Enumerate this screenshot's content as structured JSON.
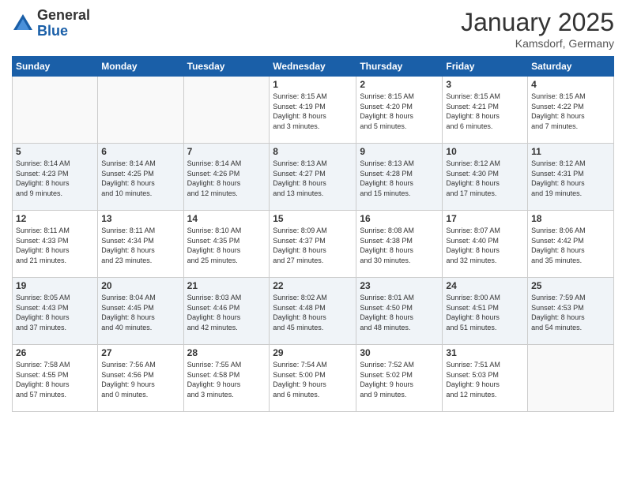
{
  "header": {
    "logo_general": "General",
    "logo_blue": "Blue",
    "month_title": "January 2025",
    "location": "Kamsdorf, Germany"
  },
  "days_of_week": [
    "Sunday",
    "Monday",
    "Tuesday",
    "Wednesday",
    "Thursday",
    "Friday",
    "Saturday"
  ],
  "weeks": [
    [
      {
        "day": "",
        "info": ""
      },
      {
        "day": "",
        "info": ""
      },
      {
        "day": "",
        "info": ""
      },
      {
        "day": "1",
        "info": "Sunrise: 8:15 AM\nSunset: 4:19 PM\nDaylight: 8 hours\nand 3 minutes."
      },
      {
        "day": "2",
        "info": "Sunrise: 8:15 AM\nSunset: 4:20 PM\nDaylight: 8 hours\nand 5 minutes."
      },
      {
        "day": "3",
        "info": "Sunrise: 8:15 AM\nSunset: 4:21 PM\nDaylight: 8 hours\nand 6 minutes."
      },
      {
        "day": "4",
        "info": "Sunrise: 8:15 AM\nSunset: 4:22 PM\nDaylight: 8 hours\nand 7 minutes."
      }
    ],
    [
      {
        "day": "5",
        "info": "Sunrise: 8:14 AM\nSunset: 4:23 PM\nDaylight: 8 hours\nand 9 minutes."
      },
      {
        "day": "6",
        "info": "Sunrise: 8:14 AM\nSunset: 4:25 PM\nDaylight: 8 hours\nand 10 minutes."
      },
      {
        "day": "7",
        "info": "Sunrise: 8:14 AM\nSunset: 4:26 PM\nDaylight: 8 hours\nand 12 minutes."
      },
      {
        "day": "8",
        "info": "Sunrise: 8:13 AM\nSunset: 4:27 PM\nDaylight: 8 hours\nand 13 minutes."
      },
      {
        "day": "9",
        "info": "Sunrise: 8:13 AM\nSunset: 4:28 PM\nDaylight: 8 hours\nand 15 minutes."
      },
      {
        "day": "10",
        "info": "Sunrise: 8:12 AM\nSunset: 4:30 PM\nDaylight: 8 hours\nand 17 minutes."
      },
      {
        "day": "11",
        "info": "Sunrise: 8:12 AM\nSunset: 4:31 PM\nDaylight: 8 hours\nand 19 minutes."
      }
    ],
    [
      {
        "day": "12",
        "info": "Sunrise: 8:11 AM\nSunset: 4:33 PM\nDaylight: 8 hours\nand 21 minutes."
      },
      {
        "day": "13",
        "info": "Sunrise: 8:11 AM\nSunset: 4:34 PM\nDaylight: 8 hours\nand 23 minutes."
      },
      {
        "day": "14",
        "info": "Sunrise: 8:10 AM\nSunset: 4:35 PM\nDaylight: 8 hours\nand 25 minutes."
      },
      {
        "day": "15",
        "info": "Sunrise: 8:09 AM\nSunset: 4:37 PM\nDaylight: 8 hours\nand 27 minutes."
      },
      {
        "day": "16",
        "info": "Sunrise: 8:08 AM\nSunset: 4:38 PM\nDaylight: 8 hours\nand 30 minutes."
      },
      {
        "day": "17",
        "info": "Sunrise: 8:07 AM\nSunset: 4:40 PM\nDaylight: 8 hours\nand 32 minutes."
      },
      {
        "day": "18",
        "info": "Sunrise: 8:06 AM\nSunset: 4:42 PM\nDaylight: 8 hours\nand 35 minutes."
      }
    ],
    [
      {
        "day": "19",
        "info": "Sunrise: 8:05 AM\nSunset: 4:43 PM\nDaylight: 8 hours\nand 37 minutes."
      },
      {
        "day": "20",
        "info": "Sunrise: 8:04 AM\nSunset: 4:45 PM\nDaylight: 8 hours\nand 40 minutes."
      },
      {
        "day": "21",
        "info": "Sunrise: 8:03 AM\nSunset: 4:46 PM\nDaylight: 8 hours\nand 42 minutes."
      },
      {
        "day": "22",
        "info": "Sunrise: 8:02 AM\nSunset: 4:48 PM\nDaylight: 8 hours\nand 45 minutes."
      },
      {
        "day": "23",
        "info": "Sunrise: 8:01 AM\nSunset: 4:50 PM\nDaylight: 8 hours\nand 48 minutes."
      },
      {
        "day": "24",
        "info": "Sunrise: 8:00 AM\nSunset: 4:51 PM\nDaylight: 8 hours\nand 51 minutes."
      },
      {
        "day": "25",
        "info": "Sunrise: 7:59 AM\nSunset: 4:53 PM\nDaylight: 8 hours\nand 54 minutes."
      }
    ],
    [
      {
        "day": "26",
        "info": "Sunrise: 7:58 AM\nSunset: 4:55 PM\nDaylight: 8 hours\nand 57 minutes."
      },
      {
        "day": "27",
        "info": "Sunrise: 7:56 AM\nSunset: 4:56 PM\nDaylight: 9 hours\nand 0 minutes."
      },
      {
        "day": "28",
        "info": "Sunrise: 7:55 AM\nSunset: 4:58 PM\nDaylight: 9 hours\nand 3 minutes."
      },
      {
        "day": "29",
        "info": "Sunrise: 7:54 AM\nSunset: 5:00 PM\nDaylight: 9 hours\nand 6 minutes."
      },
      {
        "day": "30",
        "info": "Sunrise: 7:52 AM\nSunset: 5:02 PM\nDaylight: 9 hours\nand 9 minutes."
      },
      {
        "day": "31",
        "info": "Sunrise: 7:51 AM\nSunset: 5:03 PM\nDaylight: 9 hours\nand 12 minutes."
      },
      {
        "day": "",
        "info": ""
      }
    ]
  ]
}
